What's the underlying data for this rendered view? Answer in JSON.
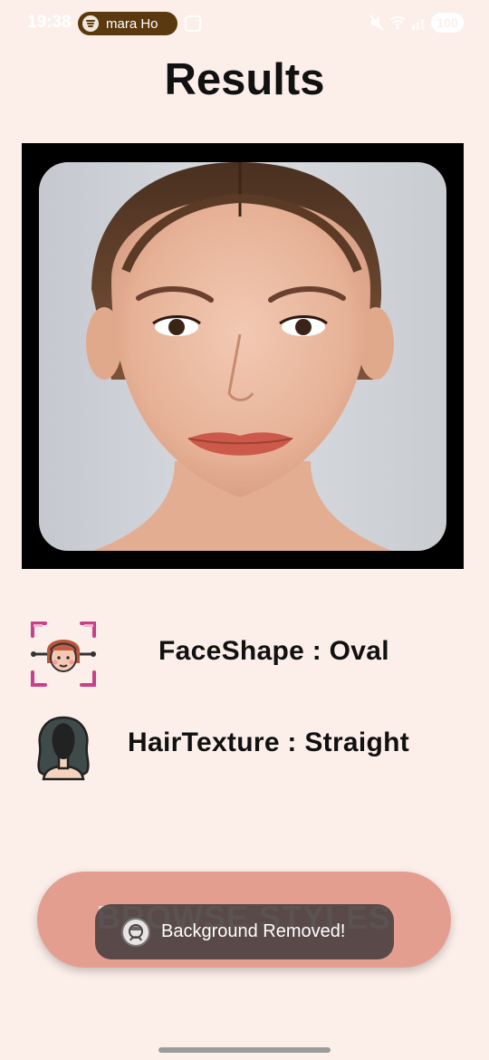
{
  "status_bar": {
    "time": "19:38",
    "media_text": "mara Ho",
    "battery": "100"
  },
  "page": {
    "title": "Results"
  },
  "photo": {
    "alt": "Uploaded face photo"
  },
  "results": {
    "face_shape_text": "FaceShape : Oval",
    "hair_texture_text": "HairTexture : Straight"
  },
  "browse_button": {
    "label": "BROWSE STYLES"
  },
  "toast": {
    "message": "Background Removed!"
  },
  "colors": {
    "background": "#fcefea",
    "button": "#e39e90",
    "toast": "#463e3e",
    "text": "#111111"
  }
}
